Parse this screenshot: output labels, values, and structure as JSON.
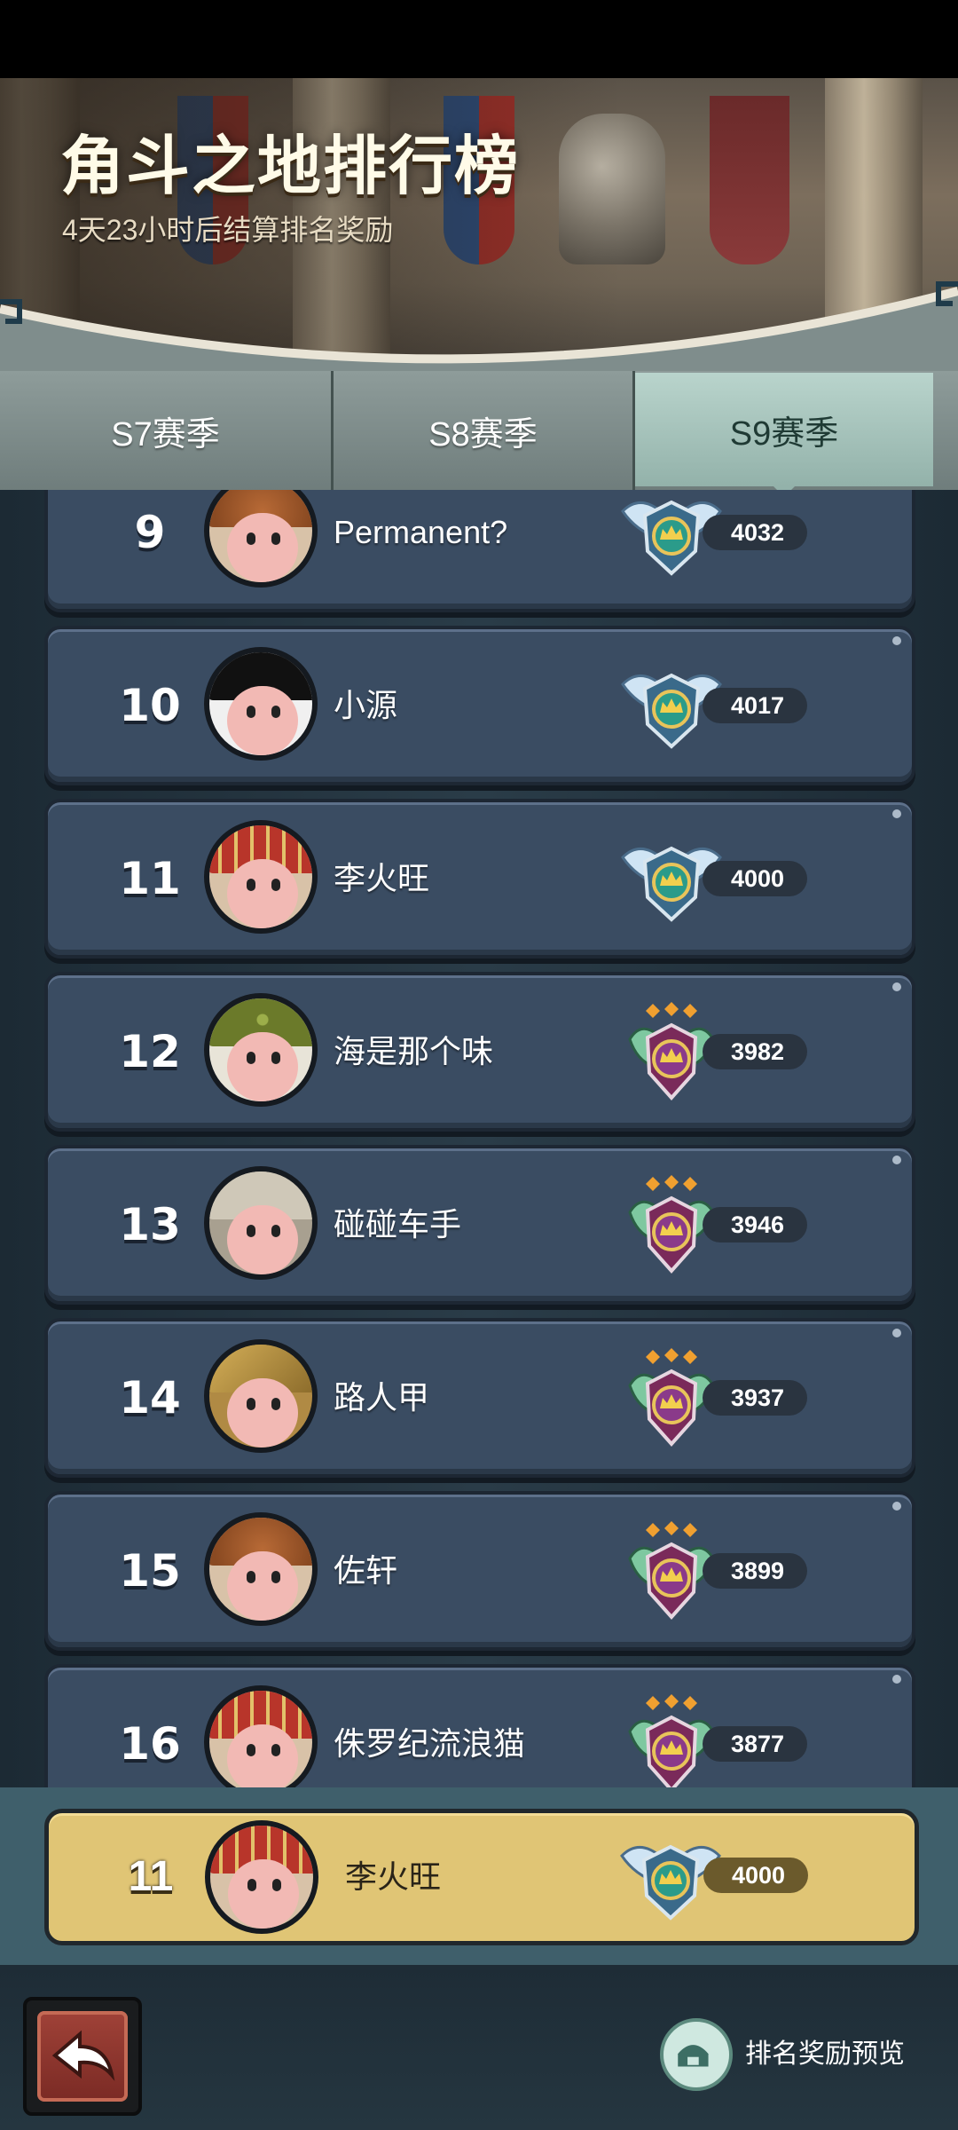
{
  "header": {
    "title": "角斗之地排行榜",
    "subtitle": "4天23小时后结算排名奖励"
  },
  "tabs": [
    {
      "label": "S7赛季",
      "selected": false
    },
    {
      "label": "S8赛季",
      "selected": false
    },
    {
      "label": "S9赛季",
      "selected": true
    }
  ],
  "leaderboard": [
    {
      "rank": "9",
      "name": "Permanent?",
      "score": "4032",
      "badge_icon": "winged-crest-icon",
      "avatar_icon": "pumpkin-hat-avatar-icon"
    },
    {
      "rank": "10",
      "name": "小源",
      "score": "4017",
      "badge_icon": "winged-crest-icon",
      "avatar_icon": "masked-bandit-avatar-icon"
    },
    {
      "rank": "11",
      "name": "李火旺",
      "score": "4000",
      "badge_icon": "winged-crest-icon",
      "avatar_icon": "red-headdress-avatar-icon"
    },
    {
      "rank": "12",
      "name": "海是那个味",
      "score": "3982",
      "badge_icon": "leaf-crest-three-gems-icon",
      "avatar_icon": "raccoon-avatar-icon"
    },
    {
      "rank": "13",
      "name": "碰碰车手",
      "score": "3946",
      "badge_icon": "leaf-crest-three-gems-icon",
      "avatar_icon": "skull-avatar-icon"
    },
    {
      "rank": "14",
      "name": "路人甲",
      "score": "3937",
      "badge_icon": "leaf-crest-three-gems-icon",
      "avatar_icon": "golden-helmet-avatar-icon"
    },
    {
      "rank": "15",
      "name": "佐轩",
      "score": "3899",
      "badge_icon": "leaf-crest-three-gems-icon",
      "avatar_icon": "pumpkin-hat-avatar-icon"
    },
    {
      "rank": "16",
      "name": "侏罗纪流浪猫",
      "score": "3877",
      "badge_icon": "leaf-crest-three-gems-icon",
      "avatar_icon": "red-headdress-avatar-icon"
    }
  ],
  "self": {
    "rank": "11",
    "name": "李火旺",
    "score": "4000",
    "badge_icon": "winged-crest-icon",
    "avatar_icon": "red-headdress-avatar-icon"
  },
  "bottom": {
    "reward_preview_label": "排名奖励预览"
  },
  "colors": {
    "row_bg": "#3a4c62",
    "self_row_bg": "#e0c575",
    "selected_tab": "#b9d4cc",
    "back_button": "#a04238"
  }
}
